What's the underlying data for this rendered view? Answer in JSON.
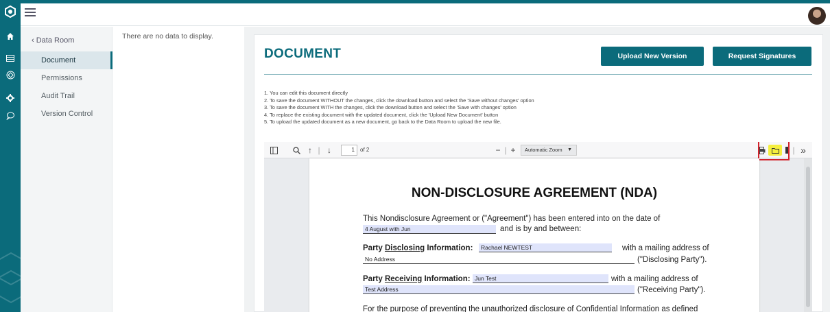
{
  "colors": {
    "brand": "#0b6b7b",
    "highlight": "#f5ef3f",
    "callout": "#d3232c",
    "field_bg": "#dfe4fb"
  },
  "rail": {
    "icons": [
      "logo-icon",
      "home-icon",
      "table-icon",
      "box-icon",
      "gear-icon",
      "chat-bubble-icon"
    ]
  },
  "sidebar": {
    "back_label": "‹ Data Room",
    "items": [
      {
        "label": "Document",
        "active": true
      },
      {
        "label": "Permissions",
        "active": false
      },
      {
        "label": "Audit Trail",
        "active": false
      },
      {
        "label": "Version Control",
        "active": false
      }
    ]
  },
  "middle": {
    "empty_text": "There are no data to display."
  },
  "main": {
    "title": "DOCUMENT",
    "upload_button": "Upload New Version",
    "sign_button": "Request Signatures",
    "instructions": [
      "1. You can edit this document directly",
      "2. To save the document WITHOUT the changes, click the download button and select the 'Save without changes' option",
      "3. To save the document WITH the changes, click the download button and select the 'Save with changes' option",
      "4. To replace the existing document with the updated document, click the 'Upload New Document' button",
      "5. To upload the updated document as a new document, go back to the Data Room to upload the new file."
    ]
  },
  "viewer": {
    "page_number": "1",
    "page_count": "of 2",
    "zoom": "Automatic Zoom"
  },
  "nda": {
    "title": "NON-DISCLOSURE AGREEMENT (NDA)",
    "intro": "This Nondisclosure Agreement or (\"Agreement\") has been entered into on the date of",
    "date_value": "4 August with Jun",
    "intro_end": "and is by and between:",
    "disclosing_label_prefix": "Party ",
    "disclosing_label_word": "Disclosing",
    "disclosing_label_suffix": " Information:",
    "disclosing_name": "Rachael NEWTEST",
    "mailing_text": "with a mailing address of",
    "disclosing_address": "No Address",
    "disclosing_party": "(\"Disclosing Party\").",
    "receiving_label_prefix": "Party ",
    "receiving_label_word": "Receiving",
    "receiving_label_suffix": " Information:",
    "receiving_name": "Jun Test",
    "receiving_address": "Test Address",
    "receiving_party": "(\"Receiving Party\").",
    "purpose": "For the purpose of preventing the unauthorized disclosure of Confidential Information as defined"
  }
}
